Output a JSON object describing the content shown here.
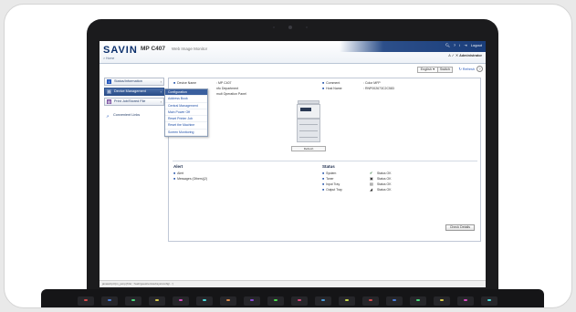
{
  "brand": {
    "logo": "SAVIN",
    "model": "MP C407",
    "subtitle": "Web Image Monitor",
    "breadcrumb": "> Home"
  },
  "header": {
    "icons": [
      "search-icon",
      "help-icon",
      "info-icon",
      "logout-icon"
    ],
    "logout_label": "Logout",
    "user_prefix": "A  ✓  ✕",
    "user": "Administrator"
  },
  "toolbar": {
    "language": "English ▾",
    "switch": "Switch",
    "refresh": "Refresh",
    "help": "?"
  },
  "nav": {
    "items": [
      {
        "label": "Status/Information",
        "icon": "info-icon"
      },
      {
        "label": "Device Management",
        "icon": "device-icon",
        "active": true
      },
      {
        "label": "Print Job/Stored File",
        "icon": "print-icon"
      }
    ],
    "links_label": "Convenient Links"
  },
  "dropdown": {
    "items": [
      "Configuration",
      "Address Book",
      "Central Management",
      "Main Power Off",
      "Reset Printer Job",
      "Reset the Machine",
      "Screen Monitoring"
    ]
  },
  "device": {
    "name_label": "Device Name",
    "name_value": ": MP C407",
    "location_value": "nfo Department",
    "panel_value": "mult Operation Panel",
    "comment_label": "Comment",
    "comment_value": ": Color MFP",
    "host_label": "Host Name",
    "host_value": ": RNP002673C2C583"
  },
  "printer_caption": "Refresh",
  "alert": {
    "title": "Alert",
    "items": [
      "Alert",
      "Messages (Others)(2)"
    ]
  },
  "status": {
    "title": "Status",
    "items": [
      {
        "label": "System",
        "value": "Status OK"
      },
      {
        "label": "Toner",
        "value": "Status OK"
      },
      {
        "label": "Input Tray",
        "value": "Status OK"
      },
      {
        "label": "Output Tray",
        "value": "Status OK"
      }
    ],
    "check_label": "Check Details"
  },
  "statusbar": "javascript:fpn_jump('link', '/web/guest/en/websys/config/...')",
  "colors": {
    "accent": "#2c4f8a",
    "link": "#1f4fa8",
    "brand": "#0b2f6b"
  }
}
